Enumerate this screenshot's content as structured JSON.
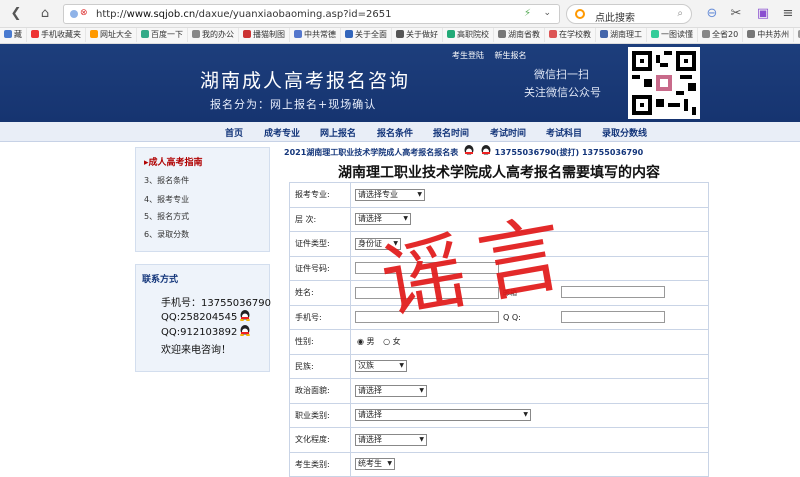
{
  "browser": {
    "url_prefix": "http://",
    "url_domain": "www.sqjob.cn",
    "url_path": "/daxue/yuanxiaobaoming.asp?id=2651",
    "search_placeholder": "点此搜索"
  },
  "bookmarks": [
    "藏",
    "手机收藏夹",
    "网址大全",
    "百度一下",
    "我的办公",
    "播猫制图",
    "中共常德",
    "关于全面",
    "关于做好",
    "高职院校",
    "湖南省教",
    "在学校教",
    "湖南理工",
    "一图读懂",
    "全省20",
    "中共苏州",
    "样板示"
  ],
  "banner": {
    "title": "湖南成人高考报名咨询",
    "subtitle": "报名分为：网上报名+现场确认",
    "links": [
      "考生登陆",
      "新生报名"
    ],
    "wechat_line1": "微信扫一扫",
    "wechat_line2": "关注微信公众号"
  },
  "nav": [
    "首页",
    "成考专业",
    "网上报名",
    "报名条件",
    "报名时间",
    "考试时间",
    "考试科目",
    "录取分数线"
  ],
  "sidebar": {
    "heading": "成人高考指南",
    "items": [
      "3、报名条件",
      "4、报考专业",
      "5、报名方式",
      "6、录取分数"
    ],
    "contact_title": "联系方式",
    "phone": "手机号：13755036790",
    "qq1": "QQ:258204545",
    "qq2": "QQ:912103892",
    "welcome": "欢迎来电咨询！"
  },
  "main": {
    "headline": "2021湖南理工职业技术学院成人高考报名报名表",
    "headline_contact": "13755036790(拔打) 13755036790",
    "form_title": "湖南理工职业技术学院成人高考报名需要填写的内容",
    "labels": {
      "major": "报考专业:",
      "level": "层 次:",
      "id_type": "证件类型:",
      "id_no": "证件号码:",
      "name": "姓名:",
      "postcode": "邮箱",
      "phone": "手机号:",
      "qq": "Q Q:",
      "gender": "性别:",
      "ethnicity": "民族:",
      "politics": "政治面貌:",
      "occupation": "职业类别:",
      "education": "文化程度:",
      "candidate_type": "考生类别:"
    },
    "selects": {
      "major": "请选择专业",
      "level": "请选择",
      "id_type": "身份证",
      "ethnicity": "汉族",
      "politics": "请选择",
      "occupation": "请选择",
      "education": "请选择",
      "candidate_type": "统考生"
    },
    "gender_male": "男",
    "gender_female": "女"
  },
  "stamp": "谣言"
}
